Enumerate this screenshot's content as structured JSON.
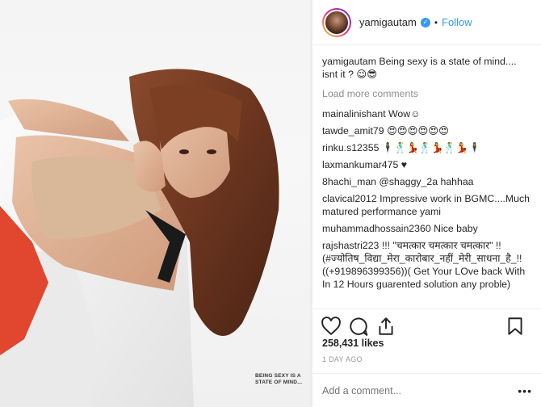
{
  "post": {
    "username": "yamigautam",
    "follow_label": "Follow",
    "dot": "•",
    "verified_glyph": "✓",
    "caption_user": "yamigautam",
    "caption_text": "Being sexy is a state of mind.... isnt it ? 😉😎",
    "load_more": "Load more comments",
    "image_caption": "BEING SEXY IS A STATE OF MIND...",
    "likes": "258,431 likes",
    "time": "1 DAY AGO",
    "add_comment_placeholder": "Add a comment...",
    "more_glyph": "•••"
  },
  "comments": [
    {
      "user": "mainalinishant",
      "text": "Wow☺"
    },
    {
      "user": "tawde_amit79",
      "text": "😍😍😍😍😍😍"
    },
    {
      "user": "rinku.s12355",
      "text": "🕴🕺💃🕺💃🕺💃🕴"
    },
    {
      "user": "laxmankumar475",
      "text": "♥"
    },
    {
      "user": "8hachi_man",
      "text": "@shaggy_2a hahhaa"
    },
    {
      "user": "clavical2012",
      "text": "Impressive work in BGMC....Much matured performance yami"
    },
    {
      "user": "muhammadhossain2360",
      "text": "Nice baby"
    },
    {
      "user": "rajshastri223",
      "text": "!!! \"चमत्कार चमत्कार चमत्कार\" !! (#ज्योतिष_विद्या_मेरा_कारोबार_नहीं_मेरी_साधना_है_!!((+919896399356))( Get Your LOve back With In 12 Hours guarented solution any proble)"
    }
  ],
  "icons": [
    "heart-icon",
    "comment-icon",
    "share-icon",
    "bookmark-icon"
  ],
  "colors": {
    "link": "#3897f0",
    "muted": "#8e8e8e",
    "text": "#262626",
    "border": "#efefef"
  }
}
